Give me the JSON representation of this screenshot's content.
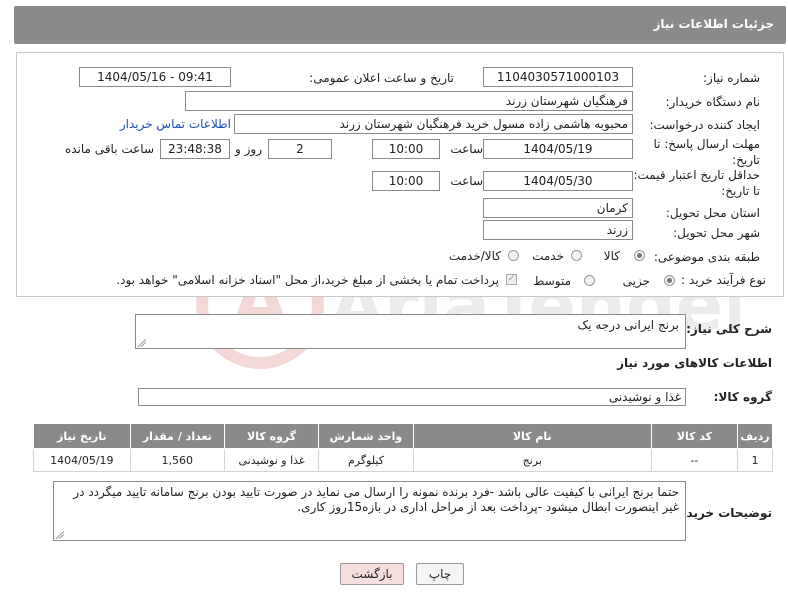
{
  "header": {
    "title": "جزئیات اطلاعات نیاز"
  },
  "fields": {
    "need_number_label": "شماره نیاز:",
    "need_number": "1104030571000103",
    "announce_label": "تاریخ و ساعت اعلان عمومی:",
    "announce_value": "1404/05/16 - 09:41",
    "buyer_org_label": "نام دستگاه خریدار:",
    "buyer_org": "فرهنگیان شهرستان زرند",
    "creator_label": "ایجاد کننده درخواست:",
    "creator": "محبوبه هاشمی زاده مسول خرید فرهنگیان شهرستان زرند",
    "contact_link": "اطلاعات تماس خریدار",
    "deadline_label_1": "مهلت ارسال پاسخ: تا",
    "deadline_label_2": "تاریخ:",
    "deadline_date": "1404/05/19",
    "time_label": "ساعت",
    "deadline_time": "10:00",
    "days_value": "2",
    "days_label": "روز و",
    "remaining_time": "23:48:38",
    "remaining_label": "ساعت باقی مانده",
    "validity_label_1": "حداقل تاریخ اعتبار قیمت:",
    "validity_label_2": "تا تاریخ:",
    "validity_date": "1404/05/30",
    "validity_time": "10:00",
    "province_label": "استان محل تحویل:",
    "province": "کرمان",
    "city_label": "شهر محل تحویل:",
    "city": "زرند",
    "category_label": "طبقه بندی موضوعی:",
    "category_options": [
      "کالا",
      "خدمت",
      "کالا/خدمت"
    ],
    "process_label": "نوع فرآیند خرید :",
    "process_options": [
      "جزیی",
      "متوسط"
    ],
    "payment_note": "پرداخت تمام یا بخشی از مبلغ خرید،از محل \"اسناد خزانه اسلامی\" خواهد بود."
  },
  "description": {
    "label": "شرح کلی نیاز:",
    "value": "برنج ایرانی درجه یک"
  },
  "goods_section": {
    "title": "اطلاعات کالاهای مورد نیاز",
    "group_label": "گروه کالا:",
    "group_value": "غذا و نوشیدنی"
  },
  "table": {
    "headers": [
      "ردیف",
      "کد کالا",
      "نام کالا",
      "واحد شمارش",
      "گروه کالا",
      "تعداد / مقدار",
      "تاریخ نیاز"
    ],
    "rows": [
      [
        "1",
        "--",
        "برنج",
        "کیلوگرم",
        "غذا و نوشیدنی",
        "1,560",
        "1404/05/19"
      ]
    ]
  },
  "buyer_notes": {
    "label": "توضیحات خریدار:",
    "value": "حتما برنج ایرانی با کیفیت عالی باشد -فرد برنده نمونه را ارسال می نماید در صورت تایید بودن برنج سامانه تایید میگردد در غیر اینصورت ابطال میشود  -پرداخت بعد از مراحل اداری در بازه15روز کاری."
  },
  "buttons": {
    "print": "چاپ",
    "back": "بازگشت"
  },
  "colors": {
    "header_bg": "#8a8a8a",
    "link": "#1a4fb5",
    "back_button_bg": "#f7dede"
  }
}
